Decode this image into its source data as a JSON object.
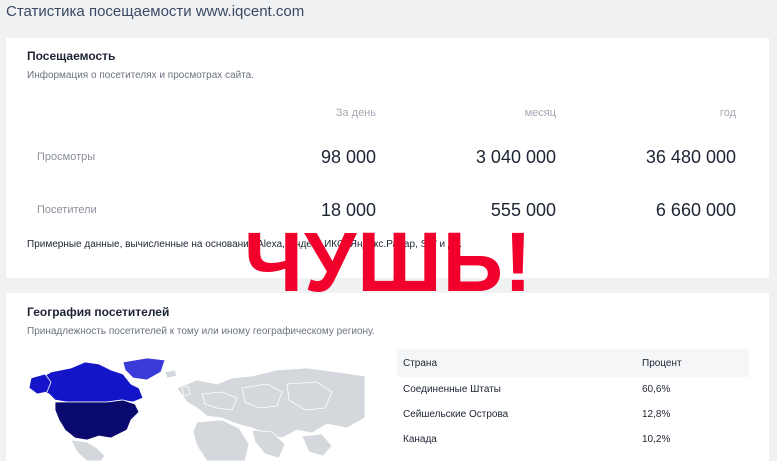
{
  "page": {
    "title": "Статистика посещаемости www.iqcent.com"
  },
  "attendance": {
    "title": "Посещаемость",
    "subtitle": "Информация о посетителях и просмотрах сайта.",
    "columns": [
      "За день",
      "месяц",
      "год"
    ],
    "rows": [
      {
        "label": "Просмотры",
        "values": [
          "98 000",
          "3 040 000",
          "36 480 000"
        ]
      },
      {
        "label": "Посетители",
        "values": [
          "18 000",
          "555 000",
          "6 660 000"
        ]
      }
    ],
    "footnote": "Примерные данные, вычисленные на основании Alexa, Яндекс ИКС, Яндекс.Радар, SW и др."
  },
  "stamp": {
    "text": "ЧУШЬ!",
    "color": "#f0002b"
  },
  "geography": {
    "title": "География посетителей",
    "subtitle": "Принадлежность посетителей к тому или иному географическому региону.",
    "table": {
      "headers": [
        "Страна",
        "Процент"
      ],
      "rows": [
        {
          "country": "Соединенные Штаты",
          "percent": "60,6%"
        },
        {
          "country": "Сейшельские Острова",
          "percent": "12,8%"
        },
        {
          "country": "Канада",
          "percent": "10,2%"
        }
      ]
    },
    "map_colors": {
      "usa": "#0a0a6e",
      "canada": "#1414c8",
      "greenland": "#3a3ad8",
      "land": "#d4d7dc",
      "border": "#ffffff"
    }
  }
}
